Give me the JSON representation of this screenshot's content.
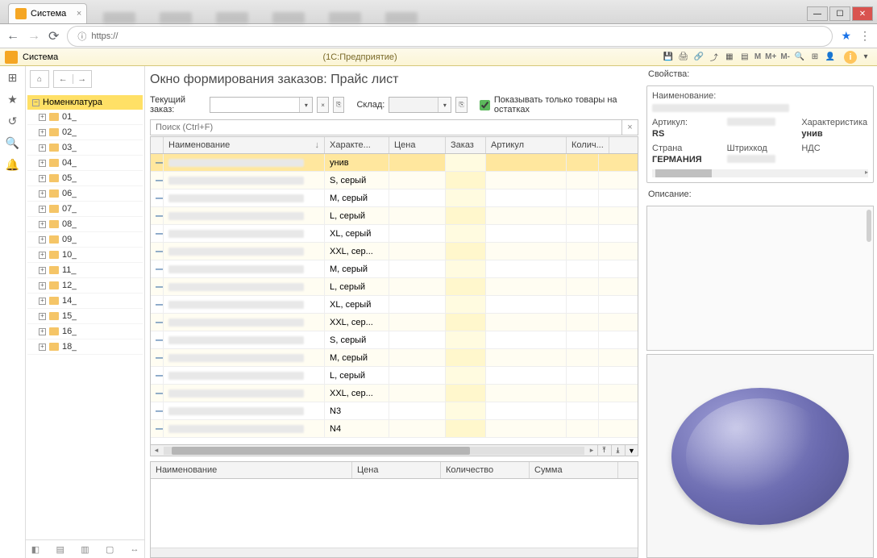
{
  "browser": {
    "tab_title": "Система",
    "url_prefix": "https://",
    "window": {
      "min": "—",
      "max": "☐",
      "close": "✕"
    }
  },
  "app": {
    "name": "Система",
    "subtitle": "(1С:Предприятие)",
    "toolbar": {
      "m": "М",
      "mplus": "М+",
      "mminus": "М-"
    }
  },
  "nav": {
    "root": "Номенклатура",
    "items": [
      "01_",
      "02_",
      "03_",
      "04_",
      "05_",
      "06_",
      "07_",
      "08_",
      "09_",
      "10_",
      "11_",
      "12_",
      "14_",
      "15_",
      "16_",
      "18_"
    ]
  },
  "page": {
    "title": "Окно формирования заказов: Прайс лист",
    "order_label": "Текущий заказ:",
    "warehouse_label": "Склад:",
    "stock_only_label": "Показывать только товары на остатках",
    "search_placeholder": "Поиск (Ctrl+F)"
  },
  "grid": {
    "cols": {
      "name": "Наименование",
      "char": "Характе...",
      "price": "Цена",
      "order": "Заказ",
      "article": "Артикул",
      "qty": "Колич..."
    },
    "rows": [
      {
        "char": "унив",
        "sel": true
      },
      {
        "char": "S, серый"
      },
      {
        "char": "M, серый"
      },
      {
        "char": "L, серый"
      },
      {
        "char": "XL, серый"
      },
      {
        "char": "XXL, сер..."
      },
      {
        "char": "M, серый"
      },
      {
        "char": "L, серый"
      },
      {
        "char": "XL, серый"
      },
      {
        "char": "XXL, сер..."
      },
      {
        "char": "S, серый"
      },
      {
        "char": "M, серый"
      },
      {
        "char": "L, серый"
      },
      {
        "char": "XXL, сер..."
      },
      {
        "char": "N3"
      },
      {
        "char": "N4"
      }
    ]
  },
  "summary": {
    "cols": {
      "name": "Наименование",
      "price": "Цена",
      "qty": "Количество",
      "sum": "Сумма"
    }
  },
  "props": {
    "title": "Свойства:",
    "name_lbl": "Наименование:",
    "article_lbl": "Артикул:",
    "article_val": "RS",
    "char_lbl": "Характеристика",
    "char_val": "унив",
    "country_lbl": "Страна",
    "country_val": "ГЕРМАНИЯ",
    "barcode_lbl": "Штрихкод",
    "vat_lbl": "НДС",
    "desc_lbl": "Описание:"
  }
}
